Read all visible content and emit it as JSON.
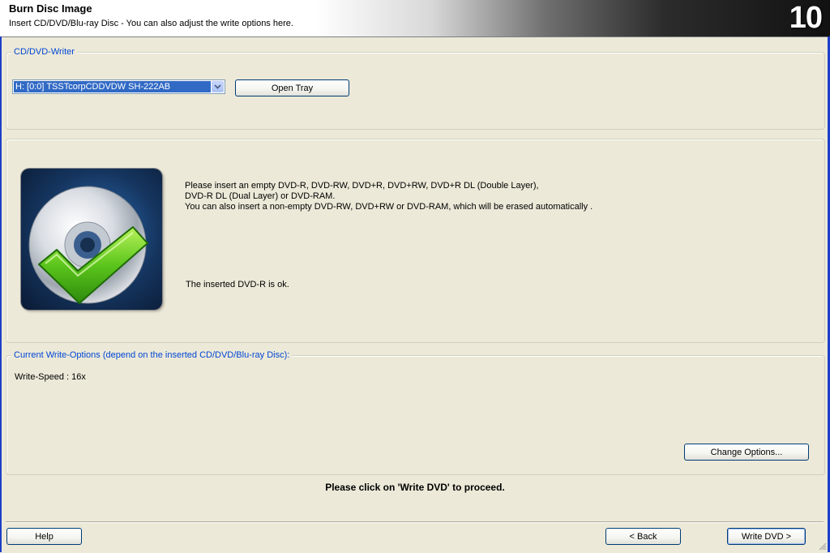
{
  "header": {
    "title": "Burn Disc Image",
    "subtitle": "Insert CD/DVD/Blu-ray Disc - You can also adjust the write options here.",
    "step_number": "10"
  },
  "writer_group": {
    "legend": "CD/DVD-Writer",
    "selected_drive": "H: [0:0] TSSTcorpCDDVDW SH-222AB",
    "open_tray_label": "Open Tray"
  },
  "disc_status": {
    "instruction_lines": [
      "Please insert an empty DVD-R, DVD-RW, DVD+R, DVD+RW, DVD+R DL (Double Layer),",
      "DVD-R DL (Dual Layer) or DVD-RAM.",
      "You can also insert a non-empty DVD-RW, DVD+RW or DVD-RAM, which will be erased automatically ."
    ],
    "status_text": "The inserted DVD-R is ok.",
    "icon": "disc-checkmark-icon"
  },
  "write_options": {
    "legend": "Current Write-Options (depend on the inserted CD/DVD/Blu-ray Disc):",
    "write_speed": "Write-Speed : 16x",
    "change_options_label": "Change Options..."
  },
  "proceed_hint": "Please click on 'Write DVD' to proceed.",
  "footer": {
    "help_label": "Help",
    "back_label": "< Back",
    "write_label": "Write DVD >"
  },
  "colors": {
    "background": "#ece9d8",
    "legend_text": "#0046d5",
    "selection": "#316ac5",
    "window_border": "#1c3fc8"
  }
}
